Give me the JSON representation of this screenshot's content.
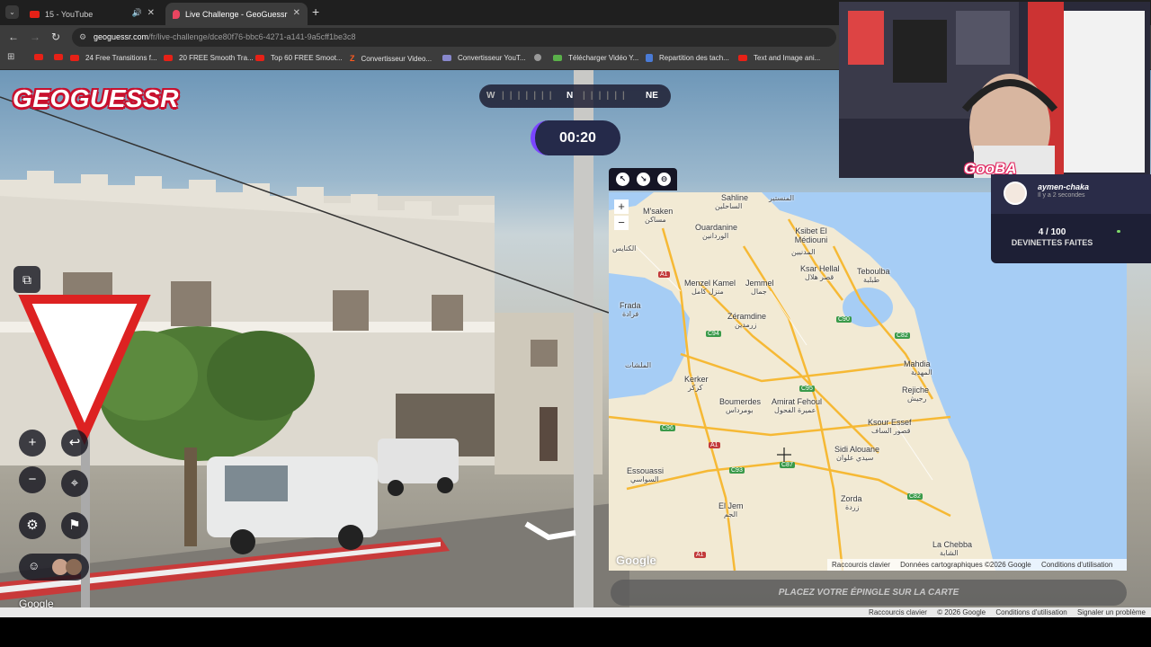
{
  "browser": {
    "tabs": [
      {
        "label": "15 - YouTube",
        "active": false
      },
      {
        "label": "Live Challenge - GeoGuessr",
        "active": true
      }
    ],
    "new_tab": "+",
    "url_host": "geoguessr.com",
    "url_path": "/fr/live-challenge/dce80f76-bbc6-4271-a141-9a5cff1be3c8",
    "bookmarks": [
      "24 Free Transitions f...",
      "20 FREE Smooth Tra...",
      "Top 60 FREE Smoot...",
      "Convertisseur Video...",
      "Convertisseur YouT...",
      "Télécharger Vidéo Y...",
      "Repartition des tach...",
      "Text and Image ani..."
    ]
  },
  "game": {
    "logo": "GEOGUESSR",
    "compass": {
      "left": "W",
      "center": "N",
      "right": "NE"
    },
    "timer": "00:20",
    "place_pin_label": "PLACEZ VOTRE ÉPINGLE SUR LA CARTE",
    "zoom_in": "+",
    "zoom_out": "−",
    "street_watermark": "Google"
  },
  "map": {
    "attribution_google": "Google",
    "shortcuts": "Raccourcis clavier",
    "map_data": "Données cartographiques ©2026 Google",
    "terms": "Conditions d'utilisation",
    "places": [
      {
        "name": "Sahline",
        "ar": "الساحلين"
      },
      {
        "name": "M'saken",
        "ar": "مساكن"
      },
      {
        "name": "Ouardanine",
        "ar": "الوردانين"
      },
      {
        "name": "Ksibet El Médiouni",
        "ar": "المدنيين"
      },
      {
        "name": "Ksar Hellal",
        "ar": "قصر هلال"
      },
      {
        "name": "Teboulba",
        "ar": "طبلبة"
      },
      {
        "name": "Menzel Kamel",
        "ar": "منزل كامل"
      },
      {
        "name": "Jemmel",
        "ar": "جمال"
      },
      {
        "name": "Frada",
        "ar": "فرادة"
      },
      {
        "name": "Zéramdine",
        "ar": "زرمدين"
      },
      {
        "name": "Mahdia",
        "ar": "المهدية"
      },
      {
        "name": "Rejiche",
        "ar": "رجيش"
      },
      {
        "name": "Kerker",
        "ar": "كركر"
      },
      {
        "name": "Boumerdes",
        "ar": "بومرداس"
      },
      {
        "name": "Amirat Fehoul",
        "ar": "عميرة الفحول"
      },
      {
        "name": "Ksour Essef",
        "ar": "قصور الساف"
      },
      {
        "name": "Sidi Alouane",
        "ar": "سيدي علوان"
      },
      {
        "name": "Essouassi",
        "ar": "السواسي"
      },
      {
        "name": "El Jem",
        "ar": "الجم"
      },
      {
        "name": "Zorda",
        "ar": "زردة"
      },
      {
        "name": "La Chebba",
        "ar": "الشابة"
      }
    ],
    "extra_ar": [
      "المنستير",
      "الكنايس",
      "الملشات"
    ],
    "roads": [
      "A1",
      "C94",
      "C90",
      "C82",
      "C95",
      "C96",
      "A1",
      "C93",
      "C87",
      "C82",
      "A1"
    ]
  },
  "status_bar": {
    "shortcuts": "Raccourcis clavier",
    "copyright": "© 2026 Google",
    "terms": "Conditions d'utilisation",
    "report": "Signaler un problème"
  },
  "overlay": {
    "streamer_tag": "GooBA",
    "user_name": "aymen-chaka",
    "user_time": "Il y a 2 secondes",
    "guesses_count": "4 / 100",
    "guesses_label": "DEVINETTES FAITES"
  },
  "colors": {
    "accent_purple": "#7a45ff",
    "brand_red": "#c8102e",
    "panel_dark": "#1d1f35"
  }
}
